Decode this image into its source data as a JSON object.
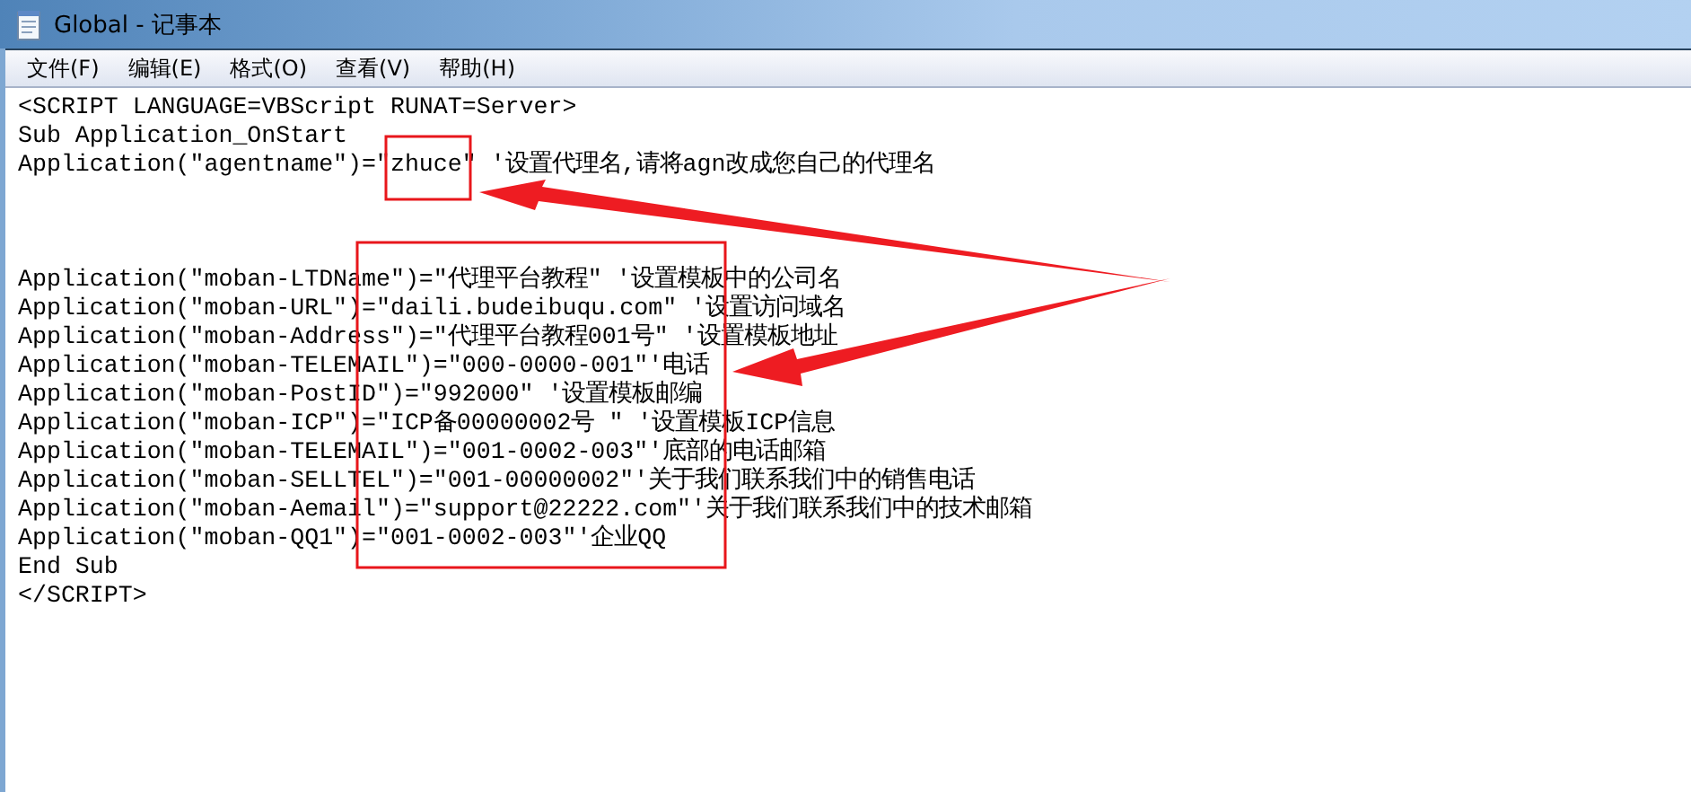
{
  "window": {
    "title": "Global - 记事本"
  },
  "menu": [
    "文件(F)",
    "编辑(E)",
    "格式(O)",
    "查看(V)",
    "帮助(H)"
  ],
  "editor": {
    "blocks": [
      {
        "lines": [
          "<SCRIPT LANGUAGE=VBScript RUNAT=Server>",
          "Sub Application_OnStart",
          "Application(\"agentname\")=\"zhuce\" '设置代理名,请将agn改成您自己的代理名"
        ]
      },
      {
        "lines": [
          "Application(\"moban-LTDName\")=\"代理平台教程\" '设置模板中的公司名",
          "Application(\"moban-URL\")=\"daili.budeibuqu.com\" '设置访问域名",
          "Application(\"moban-Address\")=\"代理平台教程001号\" '设置模板地址",
          "Application(\"moban-TELEMAIL\")=\"000-0000-001\"'电话",
          "Application(\"moban-PostID\")=\"992000\" '设置模板邮编",
          "Application(\"moban-ICP\")=\"ICP备00000002号 \" '设置模板ICP信息",
          "Application(\"moban-TELEMAIL\")=\"001-0002-003\"'底部的电话邮箱",
          "Application(\"moban-SELLTEL\")=\"001-00000002\"'关于我们联系我们中的销售电话",
          "Application(\"moban-Aemail\")=\"support@22222.com\"'关于我们联系我们中的技术邮箱",
          "Application(\"moban-QQ1\")=\"001-0002-003\"'企业QQ",
          "End Sub",
          "</SCRIPT>"
        ]
      }
    ]
  }
}
